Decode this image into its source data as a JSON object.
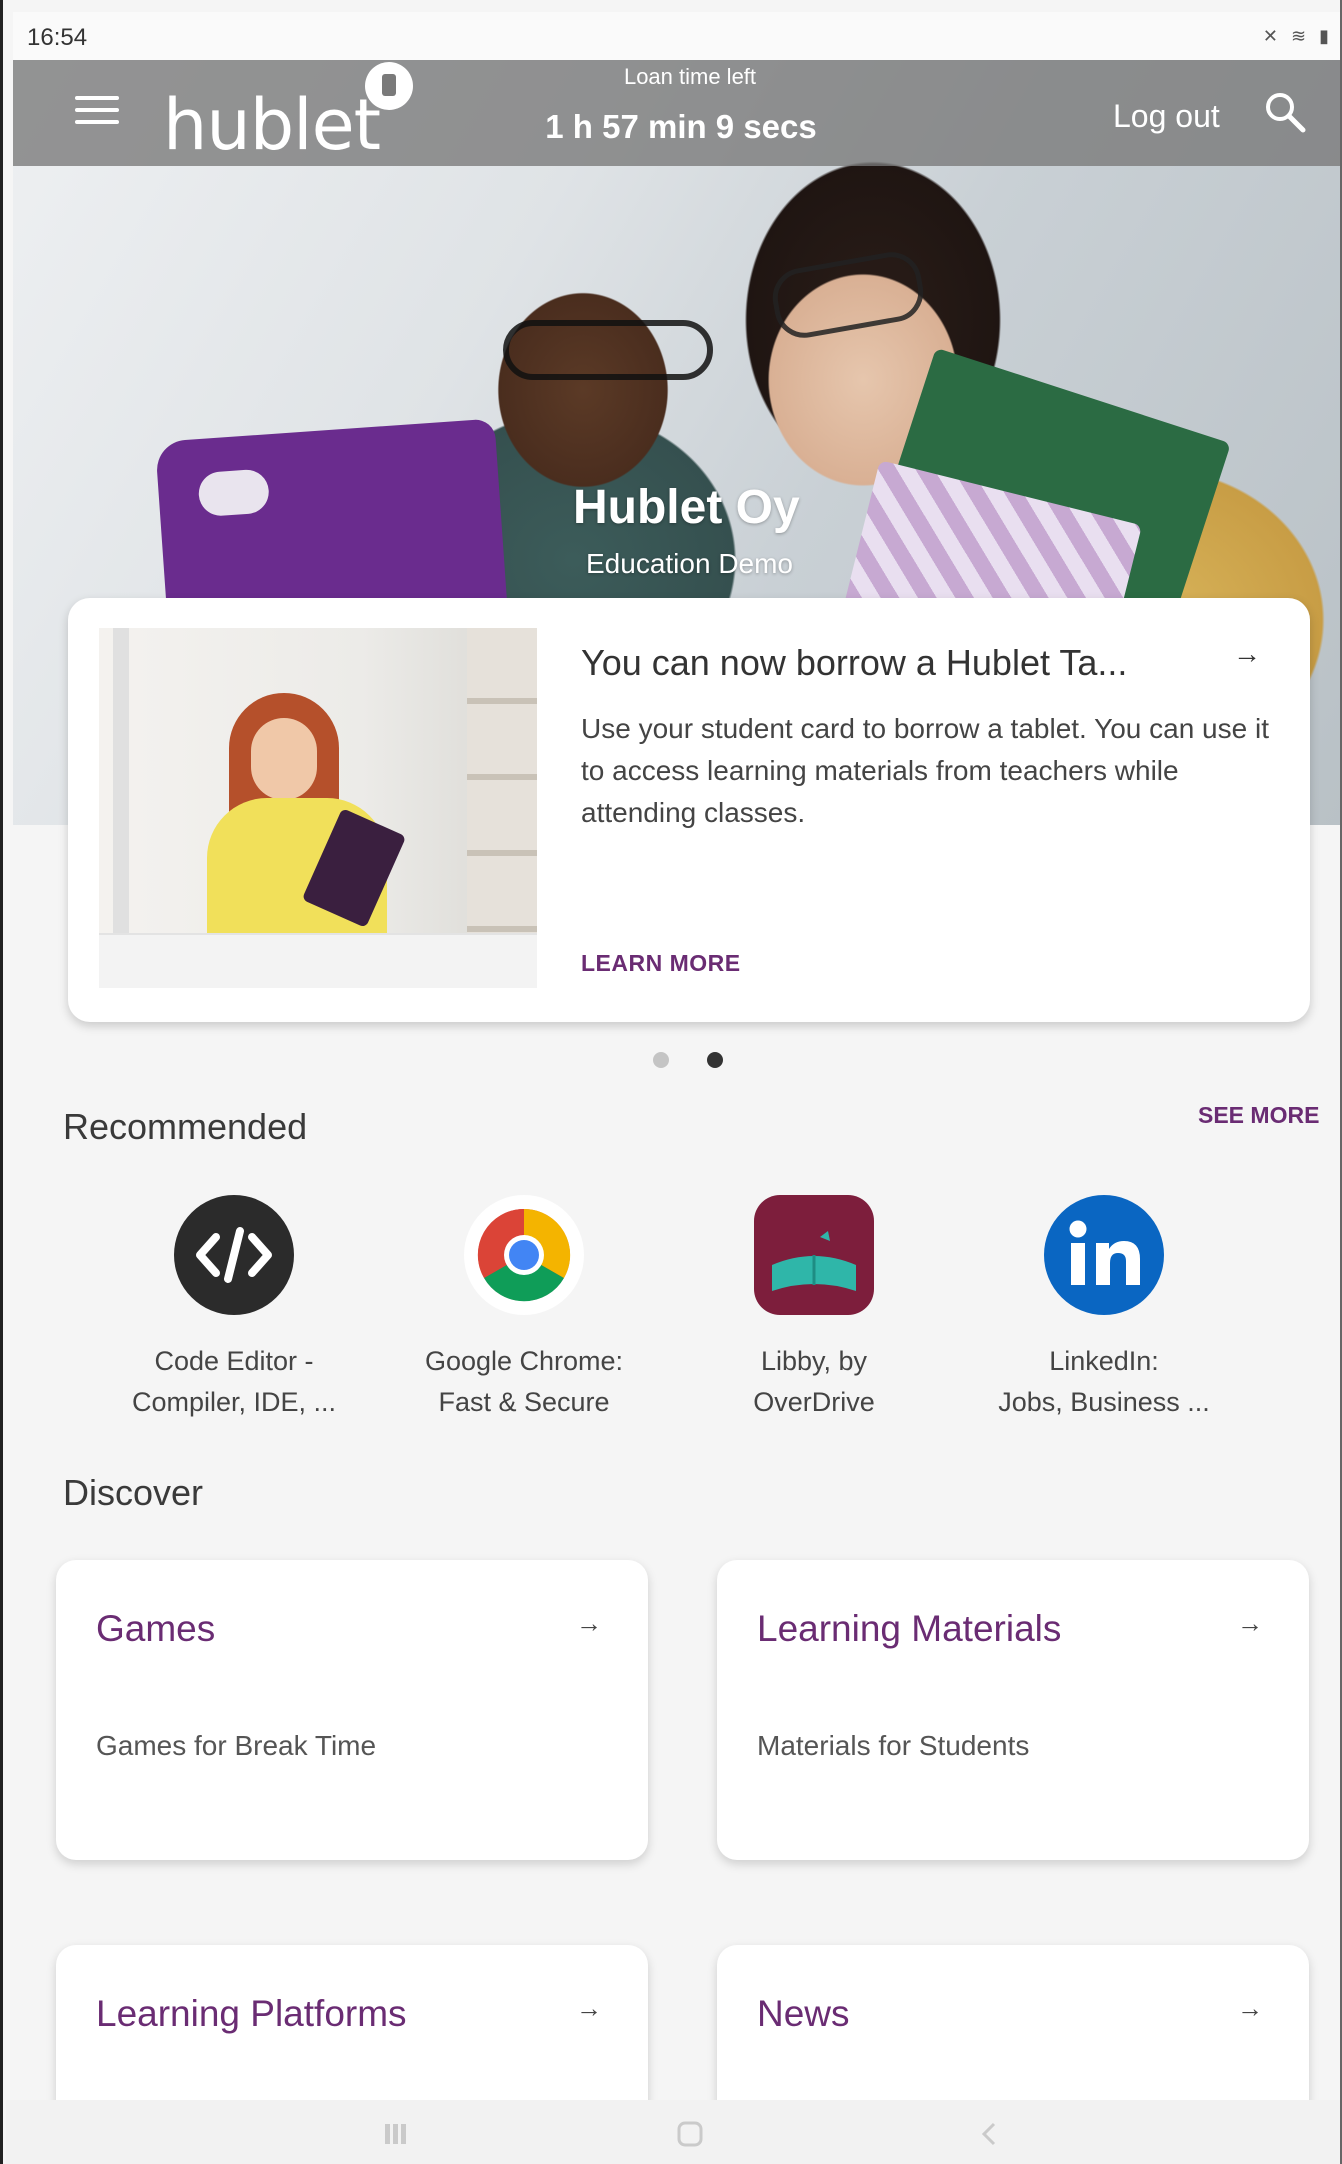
{
  "status_bar": {
    "time": "16:54",
    "icons": "✕ ≋ ▮"
  },
  "header": {
    "brand": "hublet",
    "loan_label": "Loan time left",
    "loan_time": "1 h 57 min 9 secs",
    "logout_label": "Log out"
  },
  "hero": {
    "title": "Hublet Oy",
    "subtitle": "Education Demo"
  },
  "promo": {
    "title": "You can now borrow a Hublet Ta...",
    "arrow": "→",
    "body": "Use your student card to borrow a tablet. You can use it to access learning materials from teachers while attending classes.",
    "link": "LEARN MORE"
  },
  "carousel": {
    "count": 2,
    "active_index": 1,
    "colors": {
      "active": "#333333",
      "inactive": "#c4c4c4"
    }
  },
  "recommended": {
    "title": "Recommended",
    "see_more": "SEE MORE",
    "apps": [
      {
        "line1": "Code Editor -",
        "line2": "Compiler, IDE, ...",
        "icon": "code-editor-icon"
      },
      {
        "line1": "Google Chrome:",
        "line2": "Fast & Secure",
        "icon": "chrome-icon"
      },
      {
        "line1": "Libby, by",
        "line2": "OverDrive",
        "icon": "libby-icon"
      },
      {
        "line1": "LinkedIn:",
        "line2": "Jobs, Business ...",
        "icon": "linkedin-icon"
      }
    ]
  },
  "discover": {
    "title": "Discover",
    "cards": [
      {
        "title": "Games",
        "description": "Games for Break Time",
        "arrow": "→"
      },
      {
        "title": "Learning Materials",
        "description": "Materials for Students",
        "arrow": "→"
      },
      {
        "title": "Learning Platforms",
        "description": "",
        "arrow": "→"
      },
      {
        "title": "News",
        "description": "",
        "arrow": "→"
      }
    ]
  },
  "theme": {
    "accent": "#6a2c73",
    "header_overlay": "#787878"
  }
}
